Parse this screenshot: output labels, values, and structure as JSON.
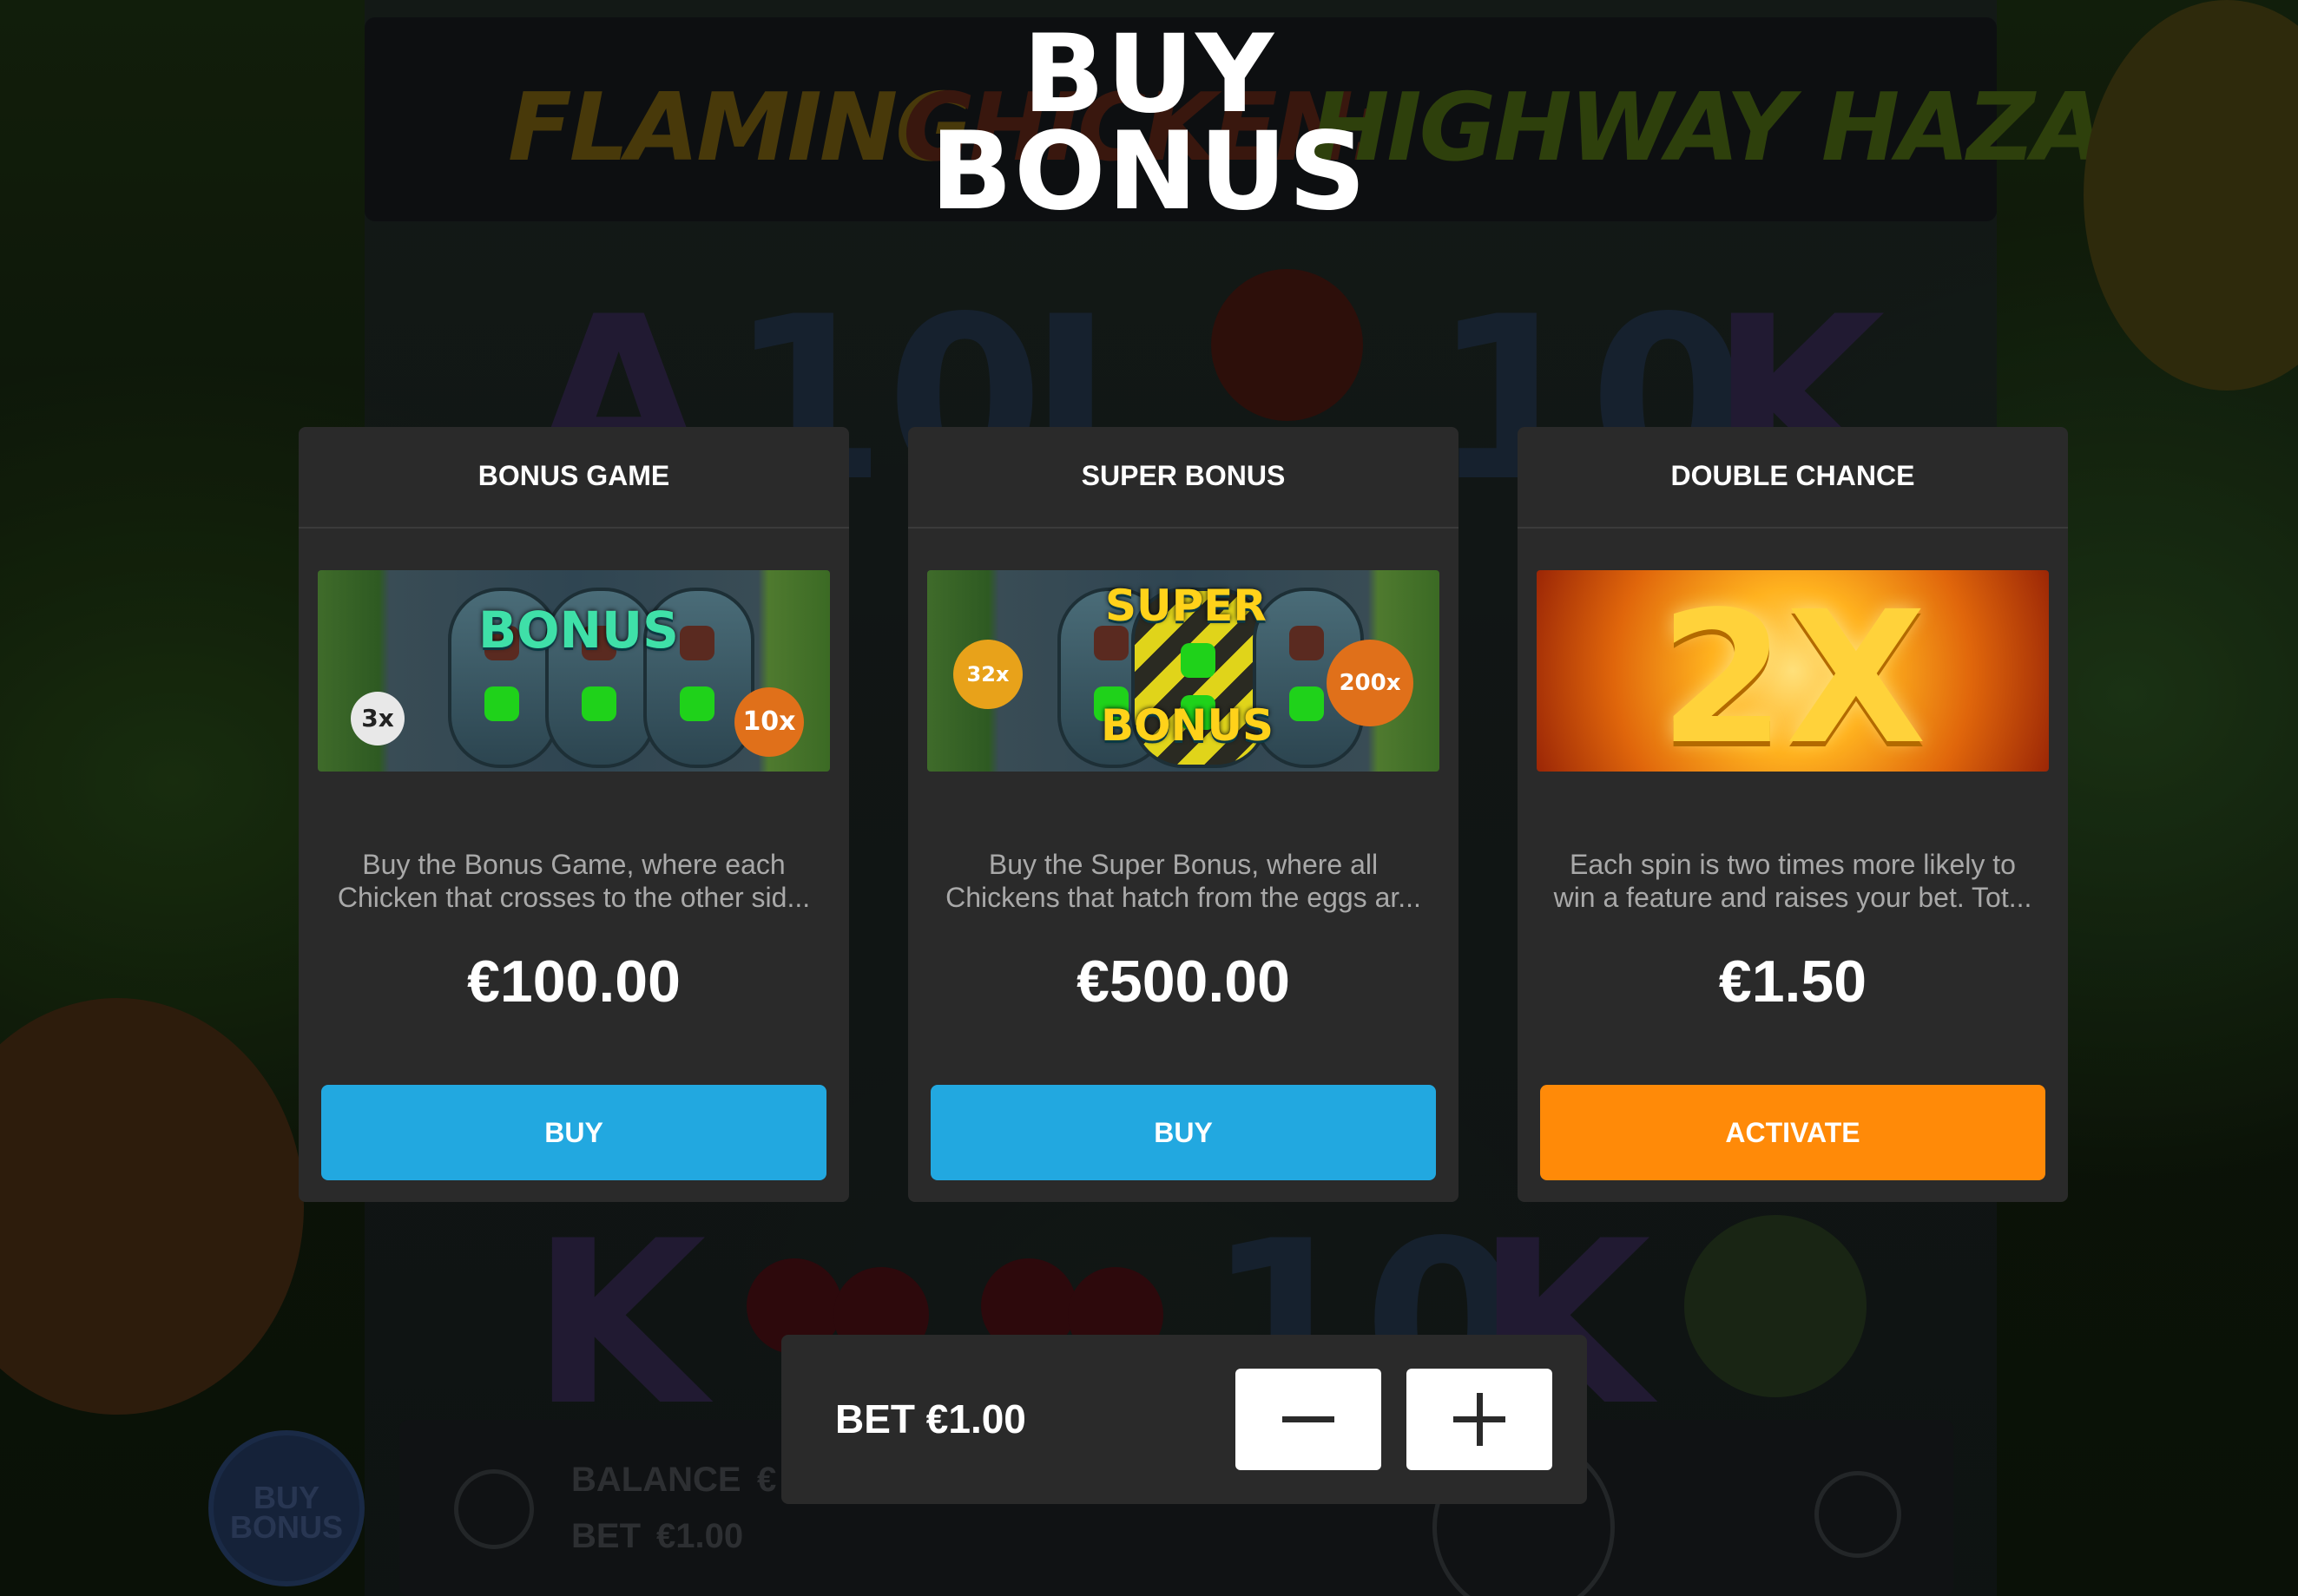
{
  "header": {
    "title_line1": "BUY",
    "title_line2": "BONUS"
  },
  "cards": [
    {
      "title": "BONUS GAME",
      "desc_line1": "Buy the Bonus Game, where each",
      "desc_line2": "Chicken that crosses to the other sid...",
      "price": "€100.00",
      "button": "BUY",
      "art": {
        "word": "BONUS",
        "left_badge": "3x",
        "right_badge": "10x"
      }
    },
    {
      "title": "SUPER BONUS",
      "desc_line1": "Buy the Super Bonus, where all",
      "desc_line2": "Chickens that hatch from the eggs ar...",
      "price": "€500.00",
      "button": "BUY",
      "art": {
        "word_top": "SUPER",
        "word_bottom": "BONUS",
        "left_badge": "32x",
        "right_badge": "200x"
      }
    },
    {
      "title": "DOUBLE CHANCE",
      "desc_line1": "Each spin is two times more likely to",
      "desc_line2": "win a feature and raises your bet. Tot...",
      "price": "€1.50",
      "button": "ACTIVATE",
      "art": {
        "word": "2X"
      }
    }
  ],
  "bet_panel": {
    "label": "BET €1.00",
    "decrease_icon": "minus-icon",
    "increase_icon": "plus-icon"
  },
  "background": {
    "logo_part1": "FLAMING",
    "logo_part2": "CHICKEN:",
    "logo_part3": "HIGHWAY HAZARD",
    "buy_bonus_button": "BUY BONUS",
    "balance_label": "BALANCE",
    "balance_value": "€",
    "bet_label": "BET",
    "bet_value": "€1.00",
    "symbols_top": [
      "A",
      "10",
      "J",
      "10",
      "K"
    ],
    "symbols_bottom": [
      "K",
      "10",
      "K"
    ]
  },
  "colors": {
    "buy_button": "#22a8e0",
    "activate_button": "#ff8a08",
    "panel": "#2a2a2a"
  }
}
